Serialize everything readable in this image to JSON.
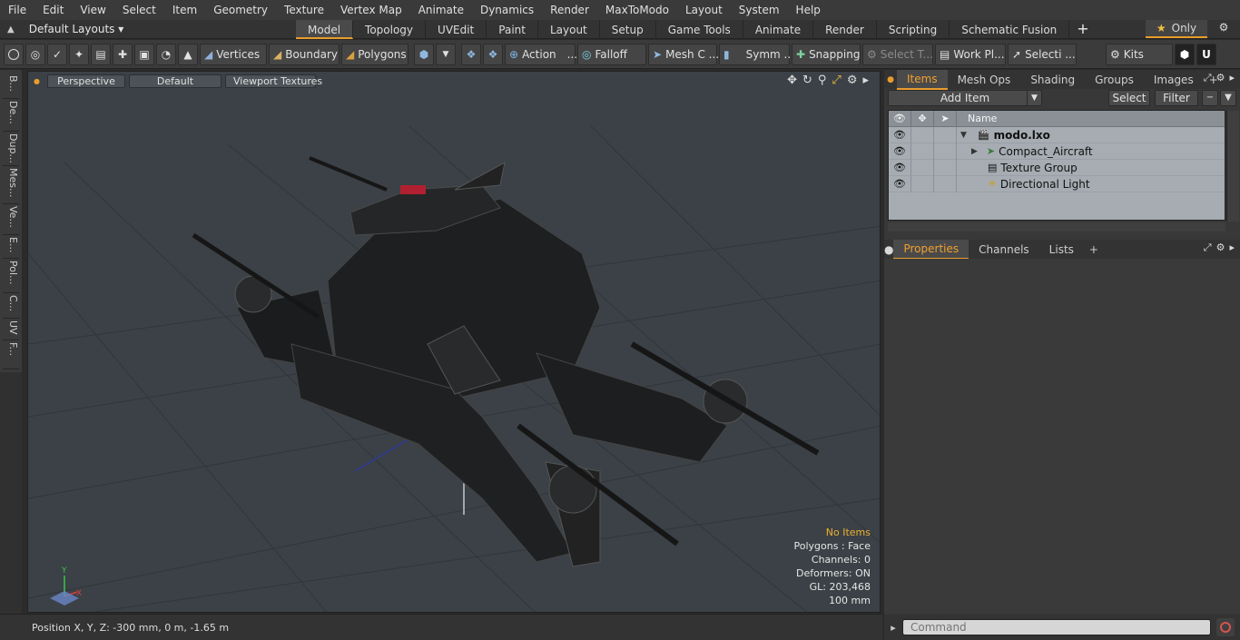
{
  "menu": [
    "File",
    "Edit",
    "View",
    "Select",
    "Item",
    "Geometry",
    "Texture",
    "Vertex Map",
    "Animate",
    "Dynamics",
    "Render",
    "MaxToModo",
    "Layout",
    "System",
    "Help"
  ],
  "layouts": {
    "label": "Default Layouts ▾"
  },
  "tabs": [
    {
      "label": "Model",
      "active": true
    },
    {
      "label": "Topology"
    },
    {
      "label": "UVEdit"
    },
    {
      "label": "Paint"
    },
    {
      "label": "Layout"
    },
    {
      "label": "Setup"
    },
    {
      "label": "Game Tools"
    },
    {
      "label": "Animate"
    },
    {
      "label": "Render"
    },
    {
      "label": "Scripting"
    },
    {
      "label": "Schematic Fusion"
    }
  ],
  "tab_plus": "+",
  "only_label": "Only",
  "toolbar": {
    "vertices": "Vertices",
    "boundary": "Boundary",
    "polygons": "Polygons",
    "action": "Action",
    "action_more": "...",
    "falloff": "Falloff",
    "mesh": "Mesh C ...",
    "symm": "Symm ...",
    "snapping": "Snapping",
    "select_t": "Select T...",
    "work_pl": "Work Pl...",
    "selecti": "Selecti ...",
    "kits": "Kits"
  },
  "left_tabs": [
    "B...",
    "De...",
    "Dup...",
    "Mes...",
    "Ve...",
    "E...",
    "Pol...",
    "C...",
    "UV",
    "F..."
  ],
  "viewport": {
    "perspective": "Perspective",
    "default": "Default",
    "textures": "Viewport Textures",
    "stats": {
      "no_items": "No Items",
      "polygons": "Polygons : Face",
      "channels": "Channels: 0",
      "deformers": "Deformers: ON",
      "gl": "GL: 203,468",
      "scale": "100 mm"
    },
    "axis_x": "X",
    "axis_y": "Y",
    "axis_z": "Z"
  },
  "status": {
    "position": "Position X, Y, Z:  -300 mm, 0 m, -1.65 m"
  },
  "items_panel": {
    "tabs": [
      {
        "label": "Items",
        "active": true
      },
      {
        "label": "Mesh Ops"
      },
      {
        "label": "Shading"
      },
      {
        "label": "Groups"
      },
      {
        "label": "Images"
      }
    ],
    "add_item": "Add Item",
    "select": "Select",
    "filter": "Filter",
    "column_name": "Name",
    "rows": [
      {
        "name": "modo.lxo",
        "bold": true
      },
      {
        "name": "Compact_Aircraft"
      },
      {
        "name": "Texture Group"
      },
      {
        "name": "Directional Light"
      }
    ]
  },
  "props_panel": {
    "tabs": [
      {
        "label": "Properties",
        "active": true
      },
      {
        "label": "Channels"
      },
      {
        "label": "Lists"
      }
    ]
  },
  "command": {
    "placeholder": "Command"
  },
  "colors": {
    "accent": "#e89c2c",
    "viewport_bg": "#3b4146",
    "list_bg": "#a6acb2"
  }
}
